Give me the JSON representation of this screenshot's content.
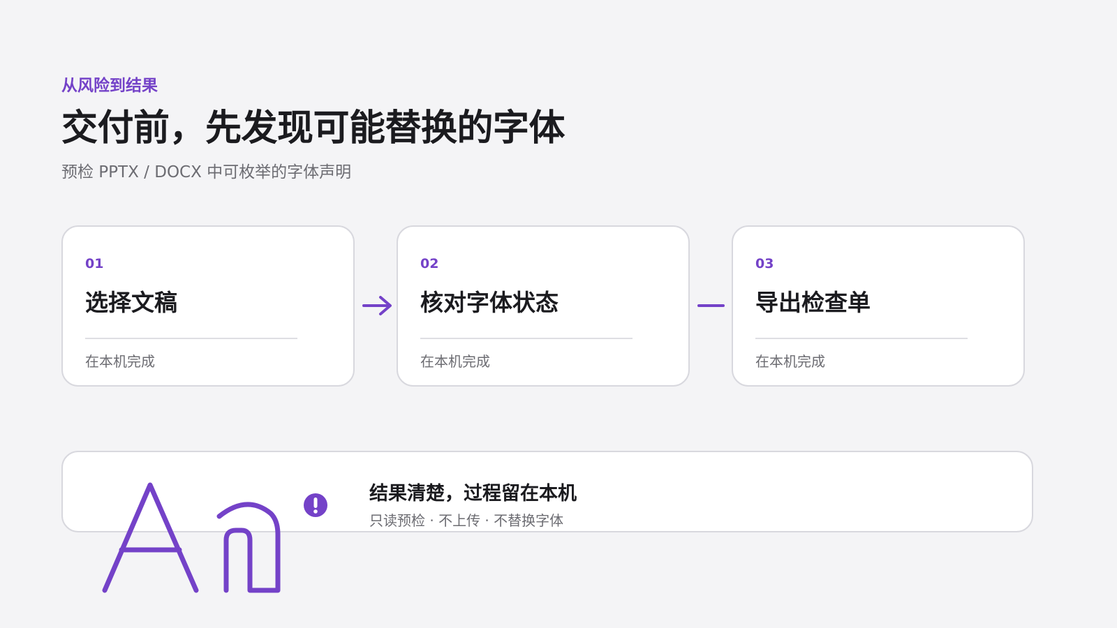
{
  "header": {
    "eyebrow": "从风险到结果",
    "title": "交付前，先发现可能替换的字体",
    "subtitle": "预检 PPTX / DOCX 中可枚举的字体声明"
  },
  "steps": [
    {
      "number": "01",
      "title": "选择文稿",
      "note": "在本机完成"
    },
    {
      "number": "02",
      "title": "核对字体状态",
      "note": "在本机完成"
    },
    {
      "number": "03",
      "title": "导出检查单",
      "note": "在本机完成"
    }
  ],
  "connectors": [
    {
      "icon": "arrow-right-icon"
    },
    {
      "icon": "dash-icon"
    }
  ],
  "banner": {
    "art_icon": "font-glyph-an-icon",
    "alert_icon": "exclamation-circle-icon",
    "title": "结果清楚，过程留在本机",
    "subtitle": "只读预检 · 不上传 · 不替换字体"
  },
  "colors": {
    "accent": "#7442c8",
    "background": "#f4f4f6",
    "card_border": "#d8d8de",
    "text_primary": "#1b1b1f",
    "text_secondary": "#6c6c72"
  }
}
